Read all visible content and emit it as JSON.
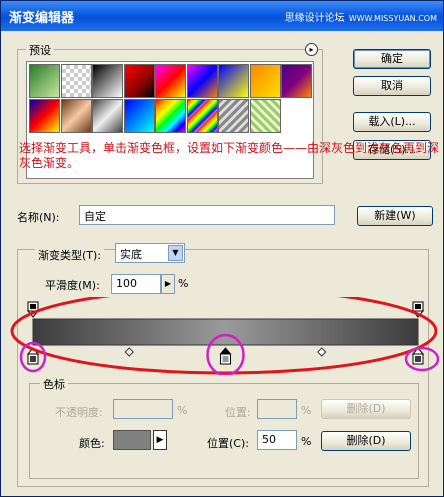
{
  "window": {
    "title": "渐变编辑器",
    "watermark": "思缘设计论坛",
    "watermark2": "WWW.MISSYUAN.COM"
  },
  "presets": {
    "label": "预设",
    "menu_icon": "arrow-right-circle-icon",
    "swatches": [
      "linear-gradient(135deg,#2a7a2a,#c8e8a0)",
      "repeating-conic-gradient(#ccc 0 25%,#fff 0 50%) 0 0/8px 8px",
      "linear-gradient(135deg,#000,#fff)",
      "linear-gradient(135deg,#ff0000,#8b0000 60%,#000)",
      "linear-gradient(135deg,#ff00ff,#ff0000,#ffff00)",
      "linear-gradient(135deg,#ff00ff,#0000ff,#ff8000)",
      "linear-gradient(135deg,#0000ff,#ffff00)",
      "linear-gradient(135deg,#ff8800,#ffdd00)",
      "linear-gradient(135deg,#4b0082,#800080,#ff8800)",
      "linear-gradient(135deg,#0000aa,#ff0000,#ffff00)",
      "linear-gradient(135deg,#6b3a1a,#f4c9a0,#6b3a1a)",
      "linear-gradient(135deg,#444,#eee,#444)",
      "linear-gradient(135deg,#0000ff,#00ffff)",
      "linear-gradient(135deg,red,orange,yellow,lime,cyan,blue,magenta)",
      "repeating-linear-gradient(135deg,red,orange,yellow,lime,blue,violet 14px)",
      "repeating-linear-gradient(135deg,#888 0 3px,#ddd 3px 6px)",
      "repeating-linear-gradient(45deg,#9ccc65 0 3px,#e8f5d0 3px 6px)"
    ]
  },
  "buttons": {
    "ok": "确定",
    "cancel": "取消",
    "load": "载入(L)...",
    "save": "存储(S)...",
    "new": "新建(W)",
    "delete_opacity": "删除(D)",
    "delete_color": "删除(D)"
  },
  "annotation": "选择渐变工具，单击渐变色框，设置如下渐变颜色——由深灰色到浅灰色再到深灰色渐变。",
  "name": {
    "label": "名称(N):",
    "value": "自定"
  },
  "type": {
    "label": "渐变类型(T):",
    "value": "实底"
  },
  "smoothness": {
    "label": "平滑度(M):",
    "value": "100",
    "unit": "%"
  },
  "gradient": {
    "stops": [
      "#3c3c3c",
      "#9a9a9a",
      "#3c3c3c"
    ],
    "color_stops": [
      0,
      50,
      100
    ],
    "opacity_stops": [
      0,
      100
    ],
    "midpoints": [
      25,
      75
    ]
  },
  "stops": {
    "label": "色标",
    "opacity_label": "不透明度:",
    "opacity_unit": "%",
    "location_label": "位置:",
    "location_unit": "%",
    "color_label": "颜色:",
    "color_swatch": "#808080",
    "color_location_label": "位置(C):",
    "color_location_value": "50",
    "color_location_unit": "%"
  },
  "accent": {
    "annotation_red": "#d0101a",
    "ellipse_red": "#e0141c",
    "circle_magenta": "#d020c8"
  }
}
